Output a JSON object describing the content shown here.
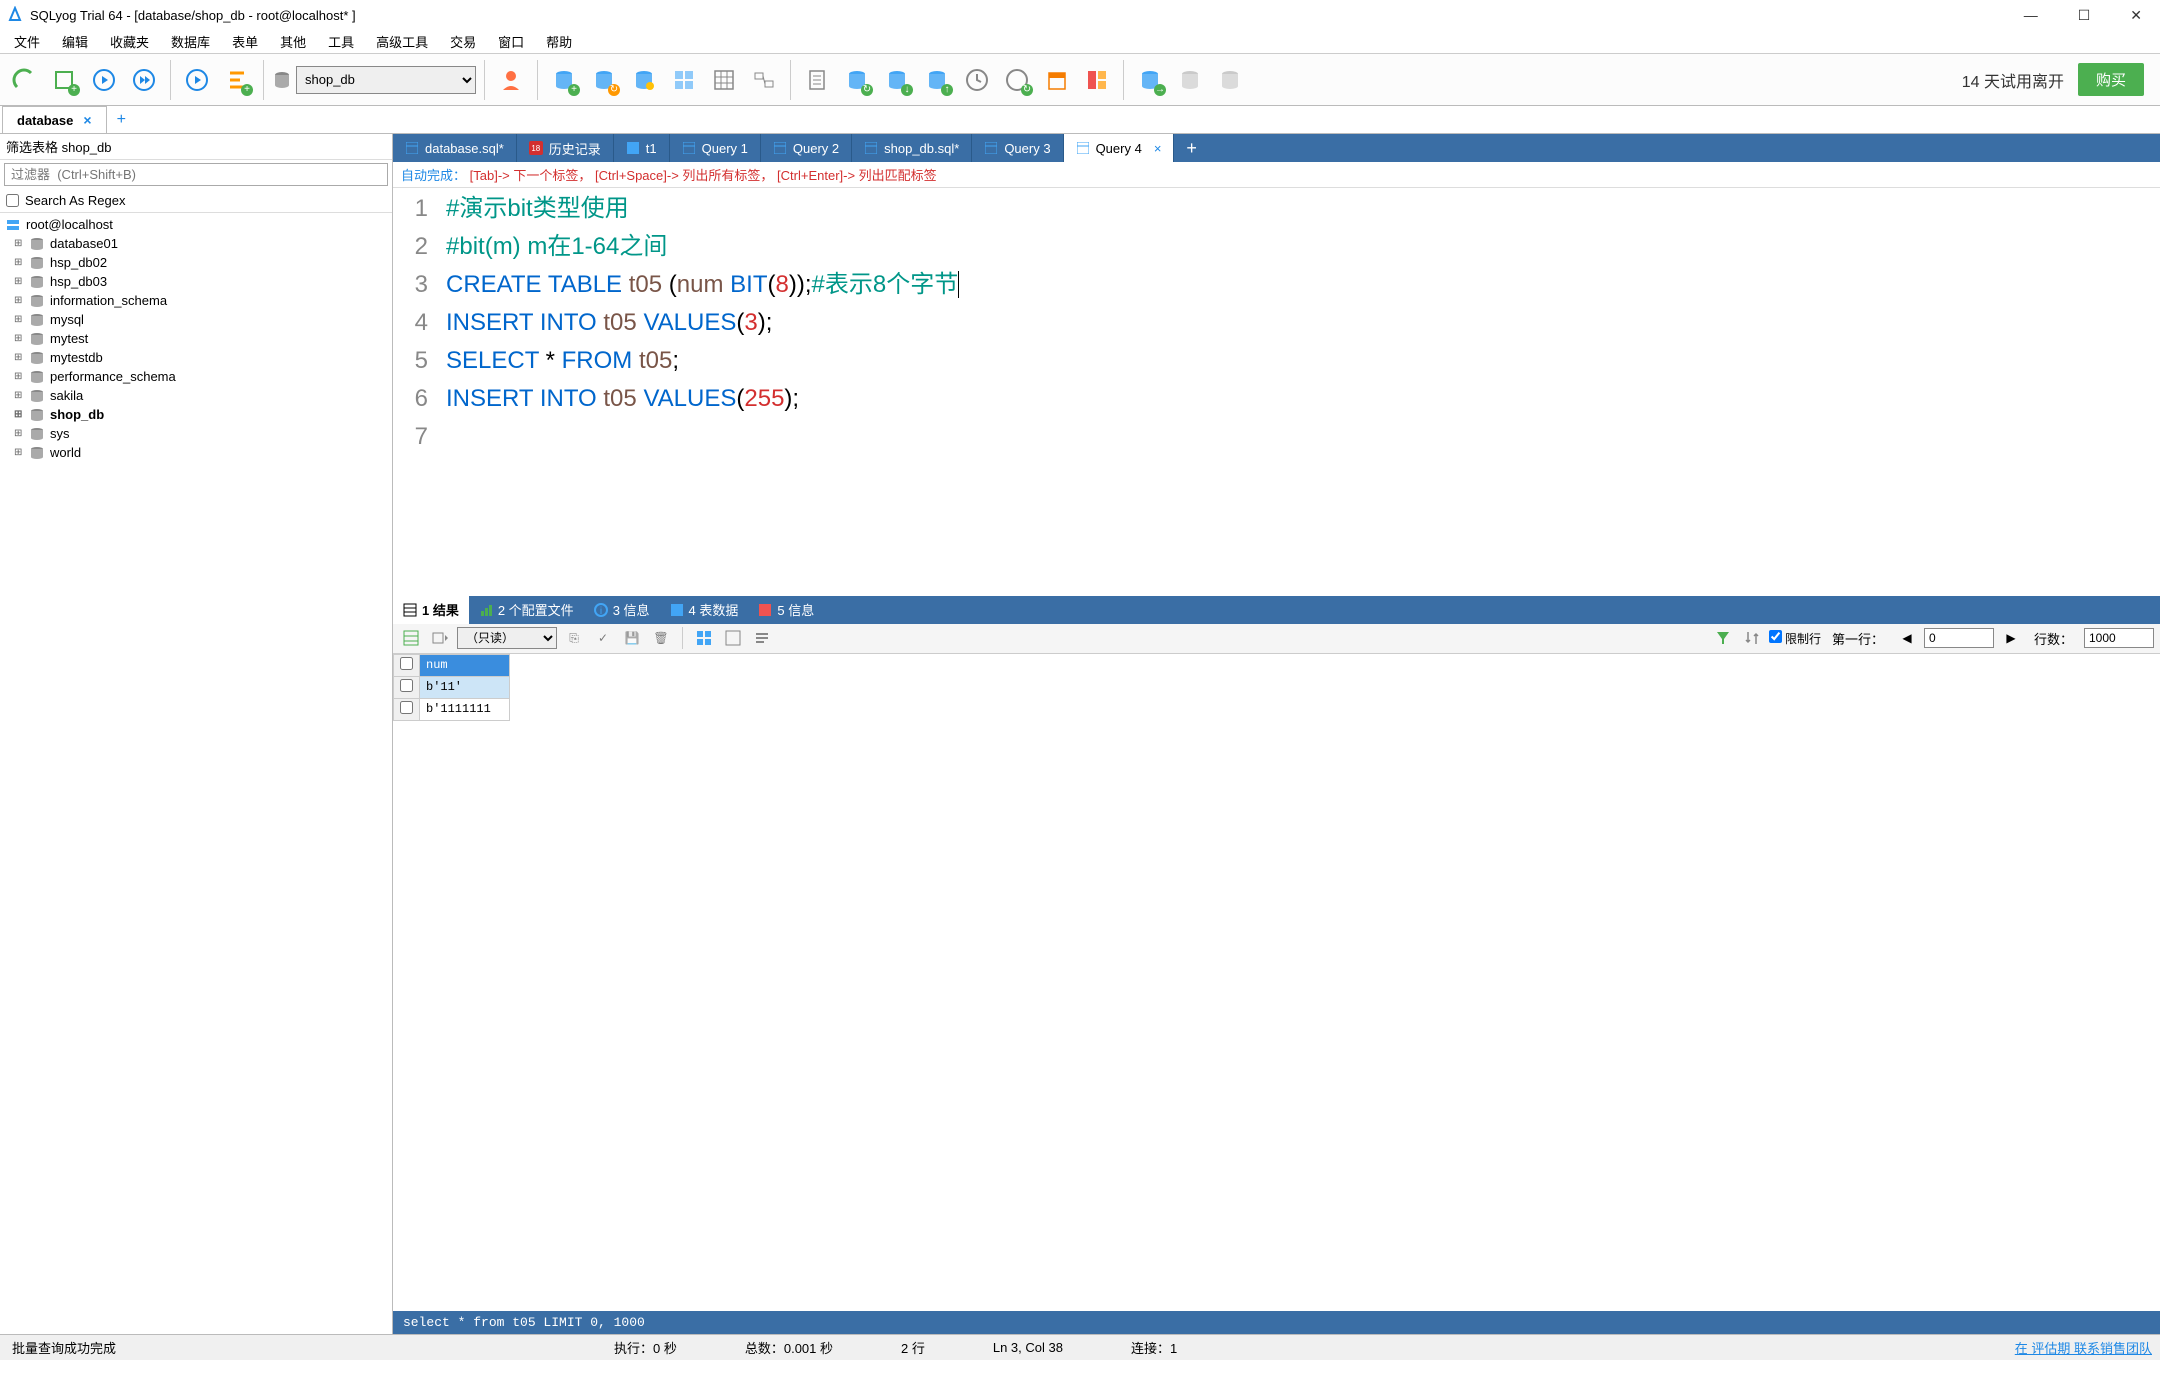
{
  "window": {
    "title": "SQLyog Trial 64 - [database/shop_db - root@localhost* ]"
  },
  "menu": {
    "items": [
      "文件",
      "编辑",
      "收藏夹",
      "数据库",
      "表单",
      "其他",
      "工具",
      "高级工具",
      "交易",
      "窗口",
      "帮助"
    ]
  },
  "toolbar": {
    "db_selected": "shop_db",
    "trial_text": "14 天试用离开",
    "buy_label": "购买"
  },
  "conn_tab": {
    "label": "database"
  },
  "sidebar": {
    "header": "筛选表格 shop_db",
    "filter_placeholder": "过滤器  (Ctrl+Shift+B)",
    "regex_label": "Search As Regex",
    "root": "root@localhost",
    "databases": [
      "database01",
      "hsp_db02",
      "hsp_db03",
      "information_schema",
      "mysql",
      "mytest",
      "mytestdb",
      "performance_schema",
      "sakila",
      "shop_db",
      "sys",
      "world"
    ],
    "active_db": "shop_db"
  },
  "query_tabs": [
    {
      "label": "database.sql*",
      "icon": "sql"
    },
    {
      "label": "历史记录",
      "icon": "history"
    },
    {
      "label": "t1",
      "icon": "table"
    },
    {
      "label": "Query 1",
      "icon": "sql"
    },
    {
      "label": "Query 2",
      "icon": "sql"
    },
    {
      "label": "shop_db.sql*",
      "icon": "sql"
    },
    {
      "label": "Query 3",
      "icon": "sql"
    },
    {
      "label": "Query 4",
      "icon": "sql",
      "active": true
    }
  ],
  "hint": {
    "prefix": "自动完成：",
    "p1": "[Tab]-> 下一个标签，",
    "p2": "[Ctrl+Space]-> 列出所有标签，",
    "p3": "[Ctrl+Enter]-> 列出匹配标签"
  },
  "code": {
    "lines": [
      {
        "n": "1",
        "html": "<span class='cmt'>#演示bit类型使用</span>"
      },
      {
        "n": "2",
        "html": "<span class='cmt'>#bit(m) m在1-64之间</span>"
      },
      {
        "n": "3",
        "html": "<span class='kw'>CREATE</span> <span class='kw'>TABLE</span> <span class='ident'>t05</span> (<span class='ident'>num</span> <span class='kw'>BIT</span>(<span class='num'>8</span>));<span class='cmt'>#表示8个字节</span><span class='cursor'></span>"
      },
      {
        "n": "4",
        "html": "<span class='kw'>INSERT</span> <span class='kw'>INTO</span> <span class='ident'>t05</span> <span class='kw'>VALUES</span>(<span class='num'>3</span>);"
      },
      {
        "n": "5",
        "html": "<span class='kw'>SELECT</span> * <span class='kw'>FROM</span> <span class='ident'>t05</span>;"
      },
      {
        "n": "6",
        "html": "<span class='kw'>INSERT</span> <span class='kw'>INTO</span> <span class='ident'>t05</span> <span class='kw'>VALUES</span>(<span class='num'>255</span>);"
      },
      {
        "n": "7",
        "html": ""
      }
    ]
  },
  "result_tabs": [
    {
      "icon": "grid",
      "label": "1 结果",
      "active": true
    },
    {
      "icon": "profile",
      "label": "2 个配置文件"
    },
    {
      "icon": "info",
      "label": "3 信息"
    },
    {
      "icon": "table",
      "label": "4 表数据"
    },
    {
      "icon": "info2",
      "label": "5 信息"
    }
  ],
  "result_toolbar": {
    "mode": "（只读）",
    "limit_label": "限制行",
    "first_label": "第一行：",
    "first_value": "0",
    "rows_label": "行数：",
    "rows_value": "1000"
  },
  "result_grid": {
    "column": "num",
    "rows": [
      "b'11'",
      "b'1111111"
    ],
    "selected_row": 0
  },
  "sql_bar": "select * from t05 LIMIT 0, 1000",
  "statusbar": {
    "msg": "批量查询成功完成",
    "exec": "执行：0 秒",
    "total": "总数：0.001 秒",
    "rows": "2 行",
    "pos": "Ln 3, Col 38",
    "conn": "连接：1",
    "link": "在 评估期 联系销售团队"
  }
}
